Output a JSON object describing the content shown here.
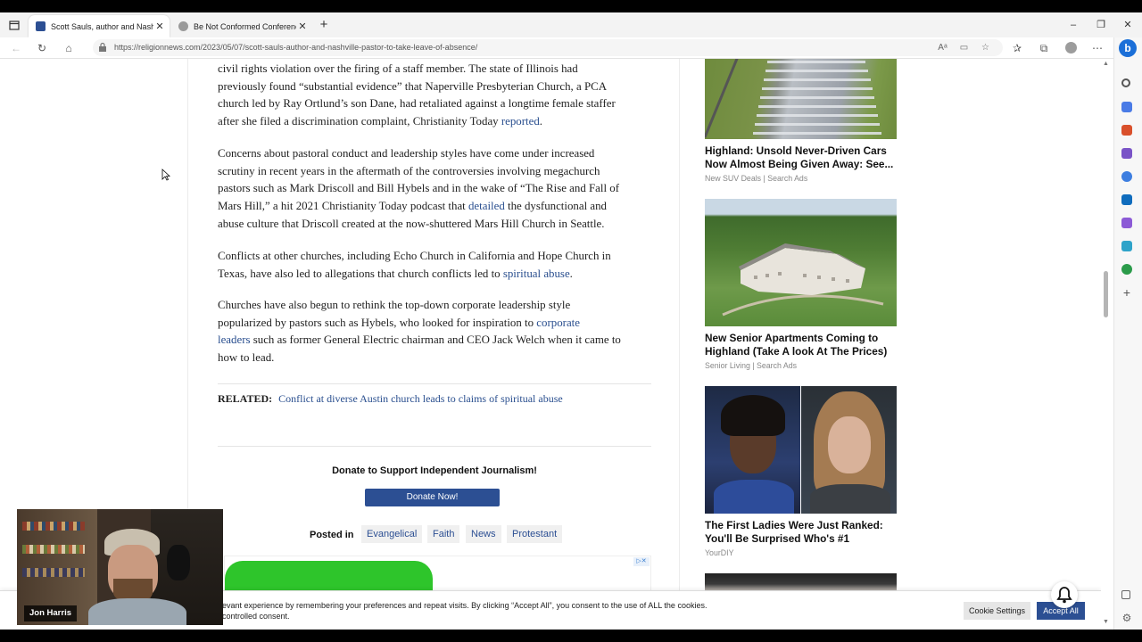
{
  "browser": {
    "tabs": [
      {
        "title": "Scott Sauls, author and Nashville",
        "active": true
      },
      {
        "title": "Be Not Conformed Conference -",
        "active": false
      }
    ],
    "url": "https://religionnews.com/2023/05/07/scott-sauls-author-and-nashville-pastor-to-take-leave-of-absence/",
    "profile_letter": "b"
  },
  "article": {
    "p1": {
      "lines": [
        "civil rights violation over the firing of a staff member. The state of Illinois had",
        "previously found “substantial evidence” that Naperville Presbyterian Church, a PCA",
        "church led by Ray Ortlund’s son Dane, had retaliated against a longtime female staffer"
      ],
      "last": "after she filed a discrimination complaint, Christianity Today ",
      "link": "reported",
      "tail": "."
    },
    "p2": {
      "l1": "Concerns about pastoral conduct and leadership styles have come under increased",
      "l2": "scrutiny in recent years in the aftermath of the controversies involving megachurch",
      "l3": "pastors such as Mark Driscoll and Bill Hybels and in the wake of “The Rise and Fall of",
      "l4a": "Mars Hill,” a hit 2021 Christianity Today podcast that ",
      "l4link": "detailed",
      "l4b": " the dysfunctional and",
      "l5": "abuse culture that Driscoll created at the now-shuttered Mars Hill Church in Seattle."
    },
    "p3": {
      "l1": "Conflicts at other churches, including Echo Church in California and Hope Church in",
      "l2a": "Texas, have also led to allegations that church conflicts led to ",
      "l2link": "spiritual abuse",
      "l2b": "."
    },
    "p4": {
      "l1": "Churches have also begun to rethink the top-down corporate leadership style",
      "l2a": "popularized by pastors such as Hybels, who looked for inspiration to ",
      "l2link": "corporate",
      "l3link": "leaders",
      "l3b": " such as former General Electric chairman and CEO Jack Welch when it came to",
      "l4": "how to lead."
    },
    "related_label": "RELATED:",
    "related_link": "Conflict at diverse Austin church leads to claims of spiritual abuse",
    "donate_heading": "Donate to Support Independent Journalism!",
    "donate_button": "Donate Now!",
    "posted_in": "Posted in",
    "tags": [
      "Evangelical",
      "Faith",
      "News",
      "Protestant"
    ]
  },
  "ads": [
    {
      "title": "Highland: Unsold Never-Driven Cars Now Almost Being Given Away: See...",
      "source": "New SUV Deals | Search Ads"
    },
    {
      "title": "New Senior Apartments Coming to Highland (Take A look At The Prices)",
      "source": "Senior Living | Search Ads"
    },
    {
      "title": "The First Ladies Were Just Ranked: You'll Be Surprised Who's #1",
      "source": "YourDIY"
    }
  ],
  "cookie": {
    "line1": "evant experience by remembering your preferences and repeat visits. By clicking “Accept All”, you consent to the use of ALL the cookies.",
    "line2": "controlled consent.",
    "settings": "Cookie Settings",
    "accept": "Accept All"
  },
  "webcam": {
    "name": "Jon Harris"
  },
  "colors": {
    "brand_blue": "#2c4f93",
    "link": "#2a4f8f",
    "green_ad": "#2ec52b"
  }
}
